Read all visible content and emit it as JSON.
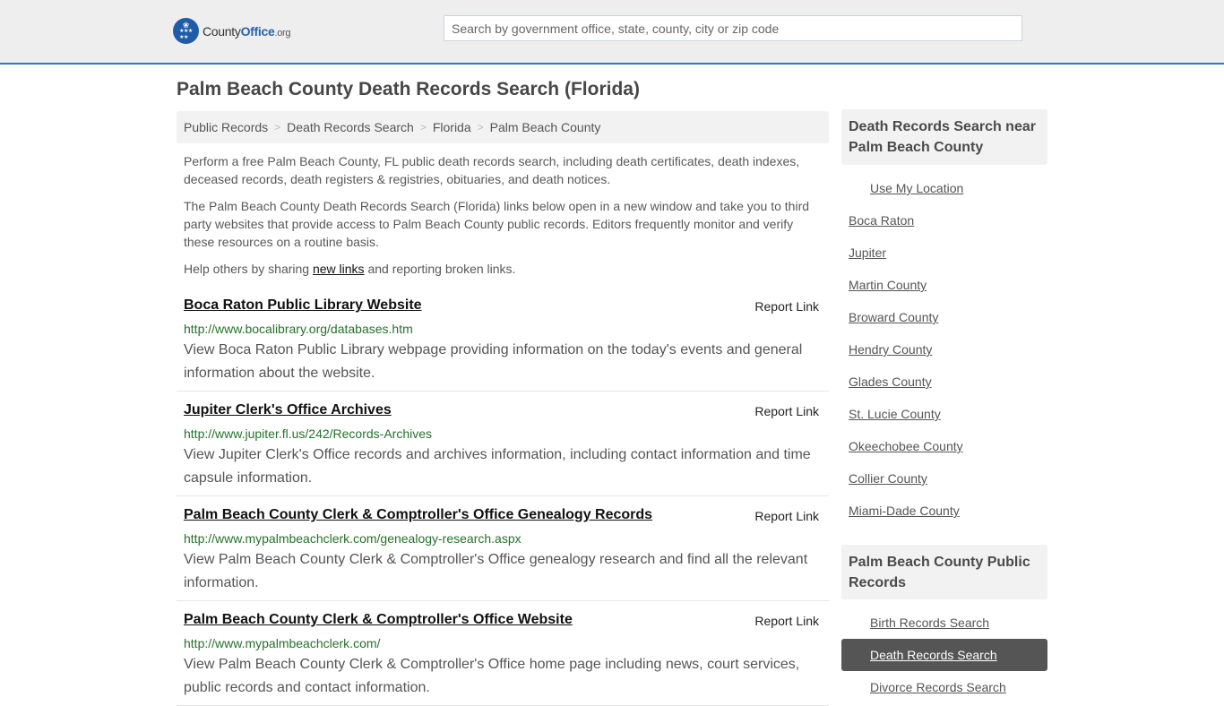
{
  "header": {
    "logo": {
      "county": "County",
      "office": "Office",
      "org": ".org"
    },
    "search_placeholder": "Search by government office, state, county, city or zip code",
    "accent_color": "#337ab7"
  },
  "page_title": "Palm Beach County Death Records Search (Florida)",
  "breadcrumb": [
    "Public Records",
    "Death Records Search",
    "Florida",
    "Palm Beach County"
  ],
  "intro": {
    "p1": "Perform a free Palm Beach County, FL public death records search, including death certificates, death indexes, deceased records, death registers & registries, obituaries, and death notices.",
    "p2": "The Palm Beach County Death Records Search (Florida) links below open in a new window and take you to third party websites that provide access to Palm Beach County public records. Editors frequently monitor and verify these resources on a routine basis.",
    "p3_before": "Help others by sharing ",
    "p3_link": "new links",
    "p3_after": " and reporting broken links."
  },
  "results": [
    {
      "title": "Boca Raton Public Library Website",
      "report": "Report Link",
      "url": "http://www.bocalibrary.org/databases.htm",
      "desc": "View Boca Raton Public Library webpage providing information on the today's events and general information about the website."
    },
    {
      "title": "Jupiter Clerk's Office Archives",
      "report": "Report Link",
      "url": "http://www.jupiter.fl.us/242/Records-Archives",
      "desc": "View Jupiter Clerk's Office records and archives information, including contact information and time capsule information."
    },
    {
      "title": "Palm Beach County Clerk & Comptroller's Office Genealogy Records",
      "report": "Report Link",
      "url": "http://www.mypalmbeachclerk.com/genealogy-research.aspx",
      "desc": "View Palm Beach County Clerk & Comptroller's Office genealogy research and find all the relevant information."
    },
    {
      "title": "Palm Beach County Clerk & Comptroller's Office Website",
      "report": "Report Link",
      "url": "http://www.mypalmbeachclerk.com/",
      "desc": "View Palm Beach County Clerk & Comptroller's Office home page including news, court services, public records and contact information."
    }
  ],
  "sidebar": {
    "nearby_heading": "Death Records Search near Palm Beach County",
    "use_location": "Use My Location",
    "nearby": [
      "Boca Raton",
      "Jupiter",
      "Martin County",
      "Broward County",
      "Hendry County",
      "Glades County",
      "St. Lucie County",
      "Okeechobee County",
      "Collier County",
      "Miami-Dade County"
    ],
    "records_heading": "Palm Beach County Public Records",
    "records": [
      "Birth Records Search",
      "Death Records Search",
      "Divorce Records Search"
    ],
    "active_record": "Death Records Search"
  }
}
